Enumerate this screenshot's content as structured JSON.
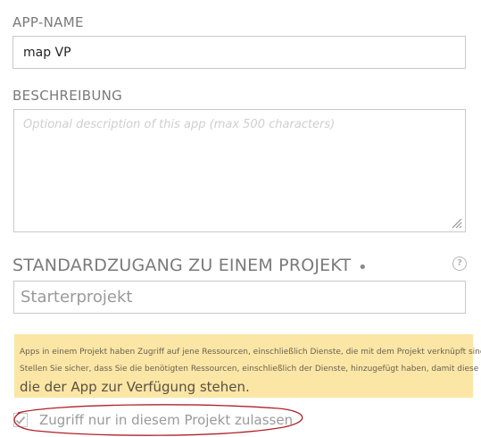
{
  "app_name": {
    "label": "APP-NAME",
    "value": "map VP"
  },
  "description": {
    "label": "BESCHREIBUNG",
    "placeholder": "Optional description of this app (max 500 characters)",
    "value": ""
  },
  "project": {
    "label": "STANDARDZUGANG ZU EINEM PROJEKT",
    "required_marker": "•",
    "help_icon": "question-circle-icon",
    "help_symbol": "?",
    "value": "Starterprojekt"
  },
  "warning": {
    "line1": "Apps in einem Projekt haben Zugriff auf jene Ressourcen, einschließlich Dienste, die mit dem Projekt verknüpft sind.",
    "line2": "Stellen Sie sicher, dass Sie die benötigten Ressourcen, einschließlich der Dienste, hinzugefügt haben, damit diese",
    "line3": "die der App zur Verfügung stehen.",
    "background": "#fbe6a6"
  },
  "restrict_access": {
    "checked": true,
    "label": "Zugriff nur in diesem Projekt zulassen",
    "annotation_color": "#b0212b"
  }
}
